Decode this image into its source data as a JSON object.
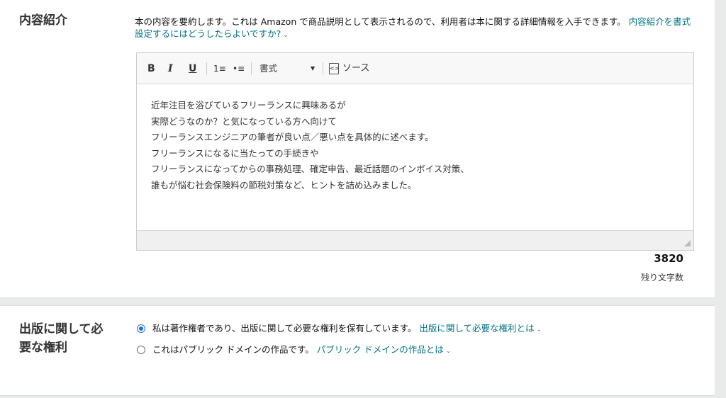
{
  "description_section": {
    "title": "内容紹介",
    "help_text": "本の内容を要約します。これは Amazon で商品説明として表示されるので、利用者は本に関する詳細情報を入手できます。",
    "help_link": "内容紹介を書式設定するにはどうしたらよいですか?",
    "toolbar": {
      "bold": "B",
      "italic": "I",
      "underline": "U",
      "ordered_list_icon": "1≡",
      "bullet_list_icon": "•≡",
      "format_select": "書式",
      "source_label": "ソース"
    },
    "content_lines": [
      "近年注目を浴びているフリーランスに興味あるが",
      "実際どうなのか？と気になっている方へ向けて",
      "フリーランスエンジニアの筆者が良い点／悪い点を具体的に述べます。",
      "フリーランスになるに当たっての手続きや",
      "フリーランスになってからの事務処理、確定申告、最近話題のインボイス対策、",
      "誰もが悩む社会保険料の節税対策など、ヒントを詰め込みました。"
    ],
    "remaining_count": "3820",
    "remaining_label": "残り文字数"
  },
  "rights_section": {
    "title_line1": "出版に関して必",
    "title_line2": "要な権利",
    "option1": {
      "label": "私は著作権者であり、出版に関して必要な権利を保有しています。",
      "link": "出版に関して必要な権利とは",
      "selected": true
    },
    "option2": {
      "label": "これはパブリック ドメインの作品です。",
      "link": "パブリック ドメインの作品とは",
      "selected": false
    }
  },
  "colors": {
    "link": "#007185",
    "radio_selected": "#1a73e8"
  }
}
